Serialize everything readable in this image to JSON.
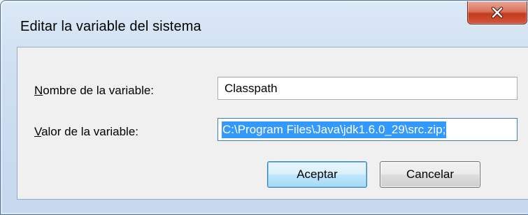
{
  "window": {
    "title": "Editar la variable del sistema"
  },
  "form": {
    "name_label_accel": "N",
    "name_label_rest": "ombre de la variable:",
    "name_value": "Classpath",
    "value_label_accel": "V",
    "value_label_rest": "alor de la variable:",
    "value_value": "C:\\Program Files\\Java\\jdk1.6.0_29\\src.zip;"
  },
  "buttons": {
    "ok_label": "Aceptar",
    "cancel_label": "Cancelar"
  },
  "icons": {
    "close": "close-icon"
  },
  "colors": {
    "selection": "#3399ff",
    "default_button_border": "#3c7fb1",
    "close_button": "#c4391c"
  }
}
